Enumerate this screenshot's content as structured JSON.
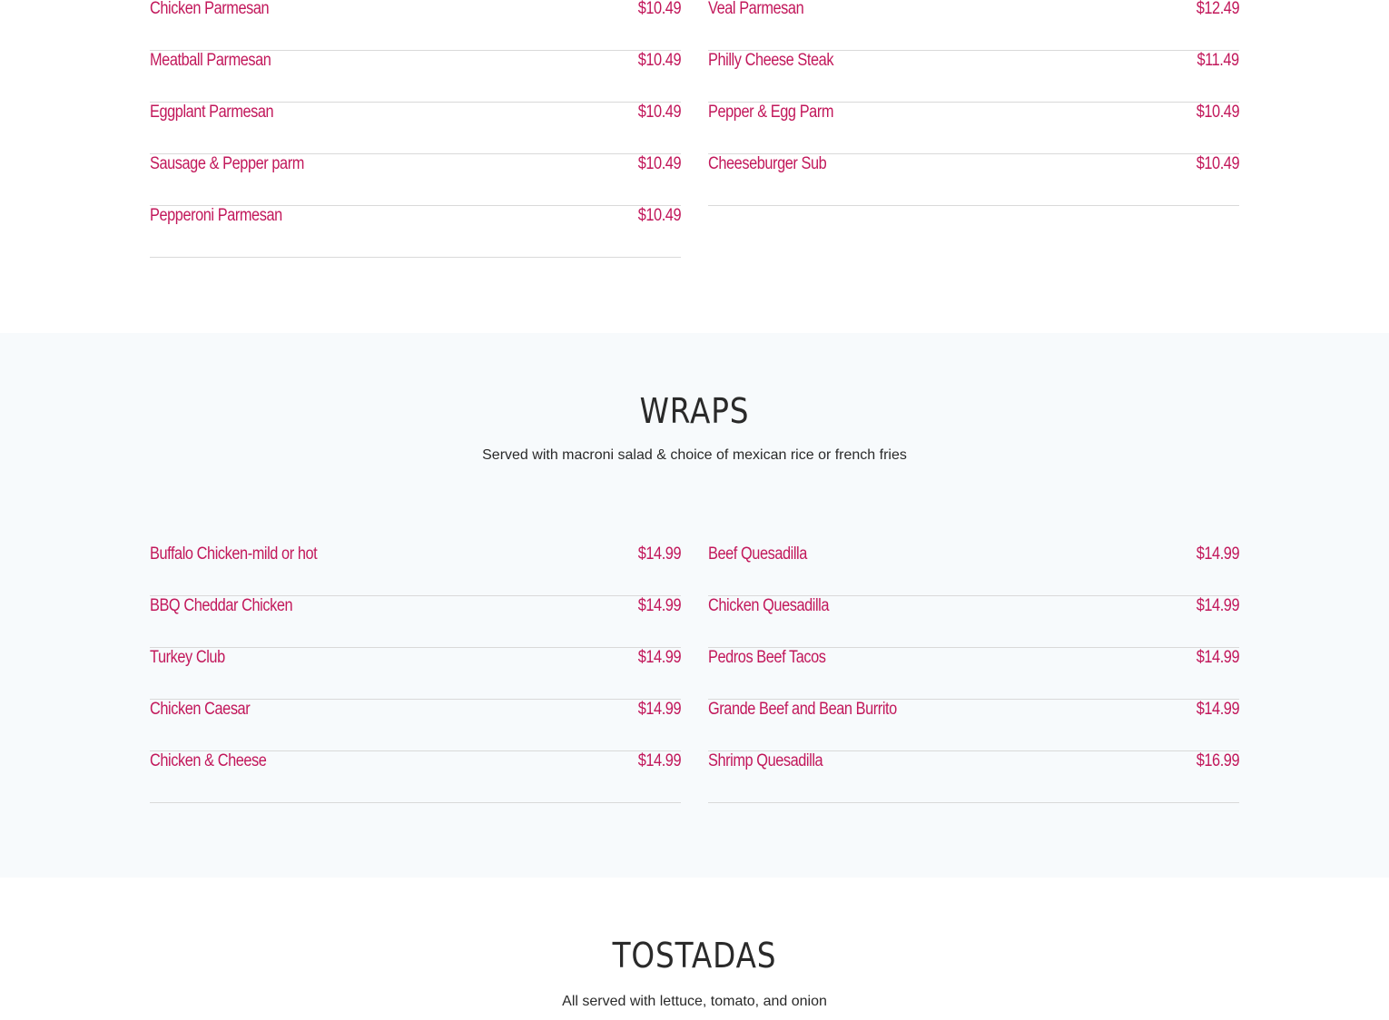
{
  "subs": {
    "left": [
      {
        "name": "Chicken Parmesan",
        "price": "$10.49"
      },
      {
        "name": "Meatball Parmesan",
        "price": "$10.49"
      },
      {
        "name": "Eggplant Parmesan",
        "price": "$10.49"
      },
      {
        "name": "Sausage & Pepper parm",
        "price": "$10.49"
      },
      {
        "name": "Pepperoni Parmesan",
        "price": "$10.49"
      }
    ],
    "right": [
      {
        "name": "Veal Parmesan",
        "price": "$12.49"
      },
      {
        "name": "Philly Cheese Steak",
        "price": "$11.49"
      },
      {
        "name": "Pepper & Egg Parm",
        "price": "$10.49"
      },
      {
        "name": "Cheeseburger Sub",
        "price": "$10.49"
      }
    ]
  },
  "wraps": {
    "title": "WRAPS",
    "subtitle": "Served with macroni salad & choice of mexican rice or french fries",
    "left": [
      {
        "name": "Buffalo Chicken-mild or hot",
        "price": "$14.99"
      },
      {
        "name": "BBQ Cheddar Chicken",
        "price": "$14.99"
      },
      {
        "name": "Turkey Club",
        "price": "$14.99"
      },
      {
        "name": "Chicken Caesar",
        "price": "$14.99"
      },
      {
        "name": "Chicken & Cheese",
        "price": "$14.99"
      }
    ],
    "right": [
      {
        "name": "Beef Quesadilla",
        "price": "$14.99"
      },
      {
        "name": "Chicken Quesadilla",
        "price": "$14.99"
      },
      {
        "name": "Pedros Beef Tacos",
        "price": "$14.99"
      },
      {
        "name": "Grande Beef and Bean Burrito",
        "price": "$14.99"
      },
      {
        "name": "Shrimp Quesadilla",
        "price": "$16.99"
      }
    ]
  },
  "tostadas": {
    "title": "TOSTADAS",
    "subtitle": "All served with lettuce, tomato, and onion"
  },
  "colors": {
    "item_text": "#c2185b",
    "heading_text": "#2a2a2a",
    "divider": "#d9d9d9",
    "alt_section_bg": "#f7fafc"
  }
}
